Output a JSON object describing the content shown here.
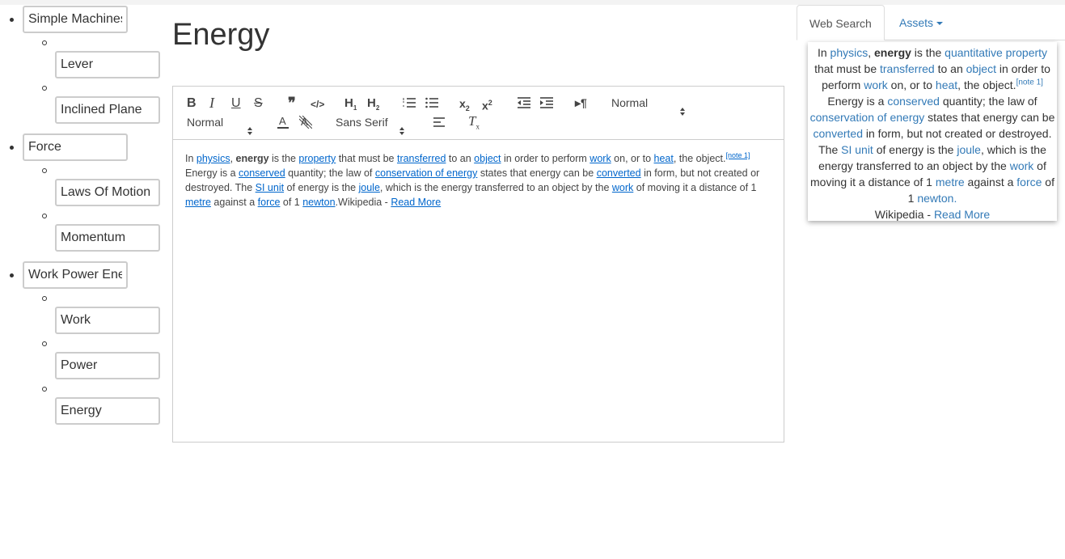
{
  "tree": [
    {
      "label": "Simple Machines",
      "children": [
        "Lever",
        "Inclined Plane"
      ]
    },
    {
      "label": "Force",
      "children": [
        "Laws Of Motion",
        "Momentum"
      ]
    },
    {
      "label": "Work Power Energy",
      "children": [
        "Work",
        "Power",
        "Energy"
      ]
    }
  ],
  "page": {
    "title": "Energy"
  },
  "toolbar": {
    "header_select": "Normal",
    "size_select": "Normal",
    "font_select": "Sans Serif"
  },
  "article": {
    "t_in": "In ",
    "l_physics": "physics",
    "t_comma": ", ",
    "b_energy": "energy",
    "t_is_the": " is the ",
    "l_property": "property",
    "t_that": " that must be ",
    "l_transferred": "transferred",
    "t_to_an": " to an ",
    "l_object": "object",
    "t_order": " in order to perform ",
    "l_work": "work",
    "t_on": " on, or to ",
    "l_heat": "heat",
    "t_the_object": ", the object.",
    "note": "[note 1]",
    "t_energy_is": " Energy is a ",
    "l_conserved": "conserved",
    "t_law": " quantity; the law of ",
    "l_conservation": "conservation of energy",
    "t_states": " states that energy can be ",
    "l_converted": "converted",
    "t_form": " in form, but not created or destroyed. The ",
    "l_si_unit": "SI unit",
    "t_of_energy": " of energy is the ",
    "l_joule": "joule",
    "t_which": ", which is the energy transferred to an object by the ",
    "l_work2": "work",
    "t_moving": " of moving it a distance of 1 ",
    "l_metre": "metre",
    "t_against": " against a ",
    "l_force": "force",
    "t_of1": " of 1 ",
    "l_newton": "newton",
    "t_wiki": ".Wikipedia - ",
    "l_read_more": "Read More"
  },
  "right_panel": {
    "tabs": [
      "Web Search",
      "Assets"
    ],
    "summary": {
      "t_in": "In ",
      "l_physics": "physics",
      "t_comma": ", ",
      "b_energy": "energy",
      "t_is_the": " is the ",
      "l_quant": "quantitative property",
      "t_that": " that must be ",
      "l_transferred": "transferred",
      "t_to_an": " to an ",
      "l_object": "object",
      "t_order": " in order to perform ",
      "l_work": "work",
      "t_on": " on, or to ",
      "l_heat": "heat",
      "t_the_object": ", the object.",
      "note": "[note 1]",
      "t_energy_is": " Energy is a ",
      "l_conserved": "conserved",
      "t_law": " quantity; the law of ",
      "l_conservation": "conservation of energy",
      "t_states": " states that energy can be ",
      "l_converted": "converted",
      "t_form": " in form, but not created or destroyed. The ",
      "l_si_unit": "SI unit",
      "t_of_energy": " of energy is the ",
      "l_joule": "joule",
      "t_which": ", which is the energy transferred to an object by the ",
      "l_work2": "work",
      "t_moving": " of moving it a distance of 1 ",
      "l_metre": "metre",
      "t_against": " against a ",
      "l_force": "force",
      "t_of1": " of 1 ",
      "l_newton": "newton.",
      "t_wiki": "Wikipedia - ",
      "l_read_more": "Read More"
    }
  }
}
